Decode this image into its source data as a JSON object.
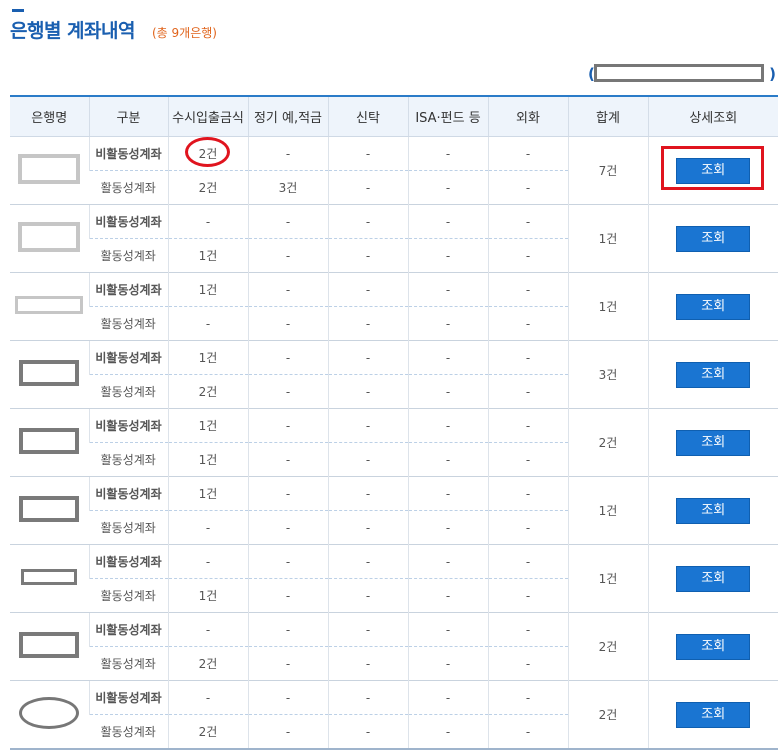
{
  "page": {
    "title": "은행별 계좌내역",
    "subtitle": "(총 9개은행)",
    "paren_open": "(",
    "paren_close": ")"
  },
  "table": {
    "headers": [
      "은행명",
      "구분",
      "수시입출금식",
      "정기 예,적금",
      "신탁",
      "ISA·펀드 등",
      "외화",
      "합계",
      "상세조회"
    ],
    "banks": [
      {
        "inactive": [
          "비활동성계좌",
          "2건",
          "-",
          "-",
          "-",
          "-"
        ],
        "active": [
          "활동성계좌",
          "2건",
          "3건",
          "-",
          "-",
          "-"
        ],
        "total": "7건",
        "button": "조회"
      },
      {
        "inactive": [
          "비활동성계좌",
          "-",
          "-",
          "-",
          "-",
          "-"
        ],
        "active": [
          "활동성계좌",
          "1건",
          "-",
          "-",
          "-",
          "-"
        ],
        "total": "1건",
        "button": "조회"
      },
      {
        "inactive": [
          "비활동성계좌",
          "1건",
          "-",
          "-",
          "-",
          "-"
        ],
        "active": [
          "활동성계좌",
          "-",
          "-",
          "-",
          "-",
          "-"
        ],
        "total": "1건",
        "button": "조회"
      },
      {
        "inactive": [
          "비활동성계좌",
          "1건",
          "-",
          "-",
          "-",
          "-"
        ],
        "active": [
          "활동성계좌",
          "2건",
          "-",
          "-",
          "-",
          "-"
        ],
        "total": "3건",
        "button": "조회"
      },
      {
        "inactive": [
          "비활동성계좌",
          "1건",
          "-",
          "-",
          "-",
          "-"
        ],
        "active": [
          "활동성계좌",
          "1건",
          "-",
          "-",
          "-",
          "-"
        ],
        "total": "2건",
        "button": "조회"
      },
      {
        "inactive": [
          "비활동성계좌",
          "1건",
          "-",
          "-",
          "-",
          "-"
        ],
        "active": [
          "활동성계좌",
          "-",
          "-",
          "-",
          "-",
          "-"
        ],
        "total": "1건",
        "button": "조회"
      },
      {
        "inactive": [
          "비활동성계좌",
          "-",
          "-",
          "-",
          "-",
          "-"
        ],
        "active": [
          "활동성계좌",
          "1건",
          "-",
          "-",
          "-",
          "-"
        ],
        "total": "1건",
        "button": "조회"
      },
      {
        "inactive": [
          "비활동성계좌",
          "-",
          "-",
          "-",
          "-",
          "-"
        ],
        "active": [
          "활동성계좌",
          "2건",
          "-",
          "-",
          "-",
          "-"
        ],
        "total": "2건",
        "button": "조회"
      },
      {
        "inactive": [
          "비활동성계좌",
          "-",
          "-",
          "-",
          "-",
          "-"
        ],
        "active": [
          "활동성계좌",
          "2건",
          "-",
          "-",
          "-",
          "-"
        ],
        "total": "2건",
        "button": "조회"
      }
    ],
    "logo_styles": [
      "light-rect",
      "light-rect",
      "light-thin-rect",
      "dark-rect",
      "dark-rect",
      "dark-rect",
      "dark-thin-rect",
      "dark-rect",
      "dark-ellipse"
    ]
  },
  "colors": {
    "accent": "#1a5fb0",
    "button": "#1a75d2",
    "highlight": "#e0141e",
    "subtitle": "#e0641c"
  }
}
